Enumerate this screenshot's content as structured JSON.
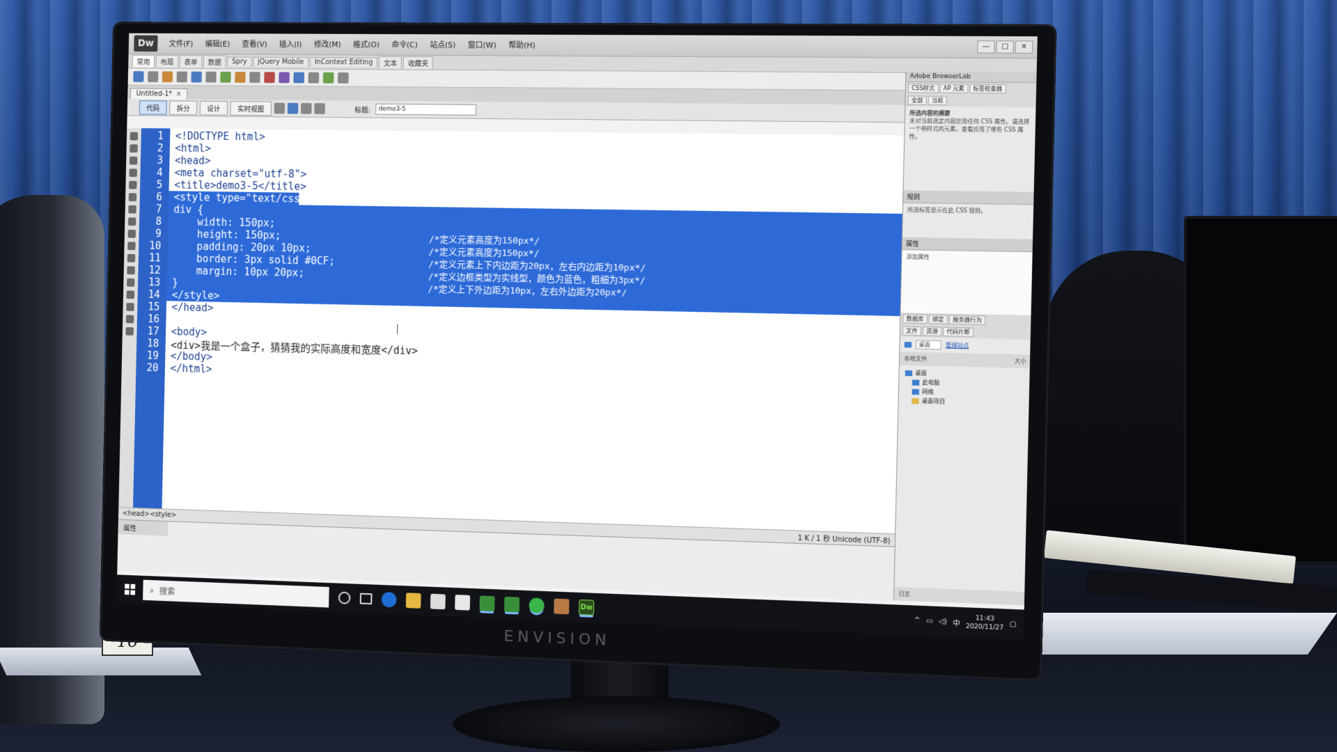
{
  "app": {
    "logo": "Dw",
    "menus": [
      "文件(F)",
      "编辑(E)",
      "查看(V)",
      "插入(I)",
      "修改(M)",
      "格式(O)",
      "命令(C)",
      "站点(S)",
      "窗口(W)",
      "帮助(H)"
    ],
    "insert_tabs": [
      "常用",
      "布局",
      "表单",
      "数据",
      "Spry",
      "jQuery Mobile",
      "InContext Editing",
      "文本",
      "收藏夹"
    ],
    "window_controls": [
      "—",
      "□",
      "×"
    ]
  },
  "document": {
    "tab_label": "Untitled-1*",
    "tab_close": "×",
    "view_buttons": [
      "代码",
      "拆分",
      "设计",
      "实时视图"
    ],
    "title_label": "标题:",
    "title_value": "demo3-5"
  },
  "code": {
    "line_numbers": [
      "1",
      "2",
      "3",
      "4",
      "5",
      "6",
      "7",
      "8",
      "9",
      "10",
      "11",
      "12",
      "13",
      "14",
      "15",
      "16",
      "17",
      "18",
      "19",
      "20"
    ],
    "lines": [
      "<!DOCTYPE html>",
      "<html>",
      "<head>",
      "<meta charset=\"utf-8\">",
      "<title>demo3-5</title>",
      "<style type=\"text/css\">",
      "div {",
      "    width: 150px;",
      "    height: 150px;",
      "    padding: 20px 10px;",
      "    border: 3px solid #0CF;",
      "    margin: 10px 20px;",
      "}",
      "</style>",
      "</head>",
      "",
      "<body>",
      "<div>我是一个盒子，猜猜我的实际高度和宽度</div>",
      "</body>",
      "</html>"
    ],
    "comments": [
      "/*定义元素高度为150px*/",
      "/*定义元素高度为150px*/",
      "/*定义元素上下内边距为20px，左右内边距为10px*/",
      "/*定义边框类型为实线型，颜色为蓝色，粗细为3px*/",
      "/*定义上下外边距为10px，左右外边距为20px*/"
    ]
  },
  "status": {
    "tag_selector": "<head><style>",
    "encoding": "1 K / 1 秒 Unicode (UTF-8)"
  },
  "properties_panel": {
    "title": "属性"
  },
  "right_panel": {
    "header": "Adobe BrowserLab",
    "css_tabs": [
      "CSS样式",
      "AP 元素",
      "标签检查器"
    ],
    "subtabs": [
      "全部",
      "当前"
    ],
    "summary_title": "所选内容的摘要",
    "summary_text": "未对当前选定内容应用任何 CSS 属性。请选择一个带样式的元素，查看应用了哪些 CSS 属性。",
    "rules_title": "规则",
    "rules_text": "所选标签显示在此 CSS 规则。",
    "props_title": "属性",
    "props_text": "添加属性",
    "files_tabs": [
      "数据库",
      "绑定",
      "服务器行为"
    ],
    "files_tabs2": [
      "文件",
      "资源",
      "代码片断"
    ],
    "site_select": "桌面",
    "manage_site": "管理站点",
    "local_files_label": "本地文件",
    "size_label": "大小",
    "tree": [
      "桌面",
      "此电脑",
      "网络",
      "桌面项目"
    ],
    "log_label": "日志"
  },
  "taskbar": {
    "search_placeholder": "搜索",
    "time": "11:43",
    "date": "2020/11/27",
    "ime": "中"
  },
  "monitor": {
    "brand": "ENVISION"
  },
  "scene": {
    "sticker": "16"
  }
}
